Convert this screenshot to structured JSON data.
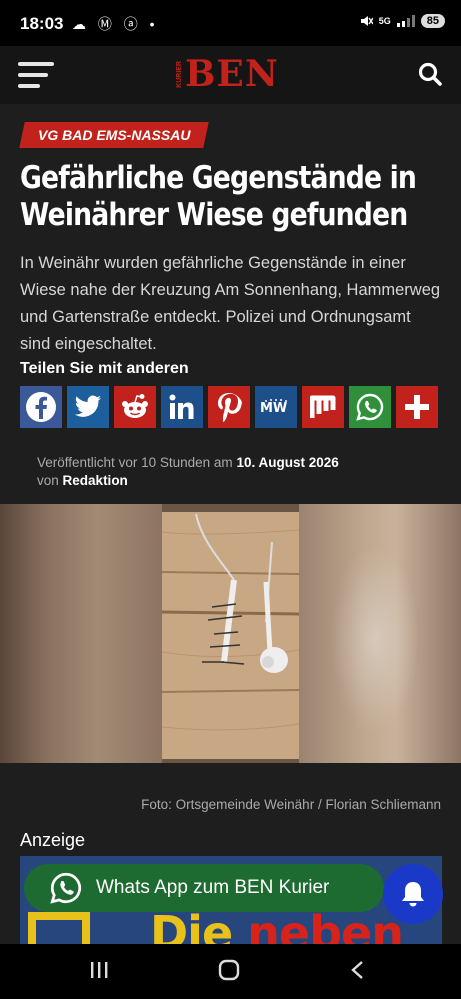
{
  "status_bar": {
    "time": "18:03",
    "icons": "☁ Ⓜ ⓐ •",
    "network": "5G",
    "battery": "85"
  },
  "header": {
    "logo_small": "KURIER",
    "logo_big": "BEN"
  },
  "article": {
    "category": "VG BAD EMS-NASSAU",
    "headline": "Gefährliche Gegenstände in Weinährer Wiese gefunden",
    "lead": "In Weinähr wurden gefährliche Gegenstände in einer Wiese nahe der Kreuzung Am Sonnenhang, Hammerweg und Gartenstraße entdeckt. Polizei und Ordnungsamt sind eingeschaltet.",
    "share_title": "Teilen Sie mit anderen",
    "share_buttons": [
      {
        "name": "facebook",
        "color": "#3b5998"
      },
      {
        "name": "twitter",
        "color": "#1c5f9c"
      },
      {
        "name": "reddit",
        "color": "#c1221b"
      },
      {
        "name": "linkedin",
        "color": "#1d4f8a"
      },
      {
        "name": "pinterest",
        "color": "#c1221b"
      },
      {
        "name": "mewe",
        "color": "#1d4f8a"
      },
      {
        "name": "mix",
        "color": "#c1221b"
      },
      {
        "name": "whatsapp",
        "color": "#2f8f3b"
      },
      {
        "name": "more",
        "color": "#c1221b"
      }
    ],
    "meta_published_prefix": "Veröffentlicht",
    "meta_ago": "vor 10 Stunden",
    "meta_am": "am",
    "meta_date": "10. August 2026",
    "meta_by": "von",
    "meta_author": "Redaktion",
    "photo_caption": "Foto: Ortsgemeinde Weinähr / Florian Schliemann"
  },
  "ad": {
    "label": "Anzeige",
    "text_part1": "Die",
    "text_part2": "neben"
  },
  "whatsapp_button": {
    "label": "Whats App zum BEN Kurier"
  },
  "colors": {
    "brand_red": "#c1221b",
    "bg": "#1e1e1e",
    "whatsapp_green": "#1d6b30",
    "bell_blue": "#1b39c9"
  }
}
